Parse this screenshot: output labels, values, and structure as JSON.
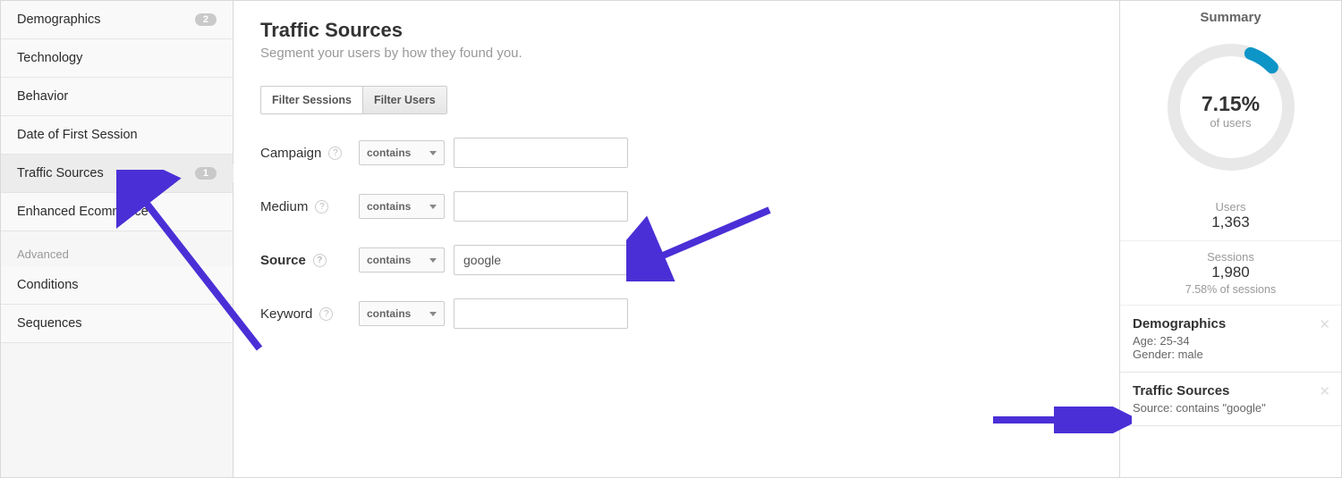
{
  "sidebar": {
    "items": [
      {
        "label": "Demographics",
        "badge": "2"
      },
      {
        "label": "Technology"
      },
      {
        "label": "Behavior"
      },
      {
        "label": "Date of First Session"
      },
      {
        "label": "Traffic Sources",
        "badge": "1",
        "active": true
      },
      {
        "label": "Enhanced Ecommerce"
      }
    ],
    "advanced_label": "Advanced",
    "advanced_items": [
      {
        "label": "Conditions"
      },
      {
        "label": "Sequences"
      }
    ]
  },
  "main": {
    "title": "Traffic Sources",
    "subtitle": "Segment your users by how they found you.",
    "filter_tabs": {
      "sessions": "Filter Sessions",
      "users": "Filter Users"
    },
    "fields": {
      "campaign": {
        "label": "Campaign",
        "op": "contains",
        "value": ""
      },
      "medium": {
        "label": "Medium",
        "op": "contains",
        "value": ""
      },
      "source": {
        "label": "Source",
        "op": "contains",
        "value": "google"
      },
      "keyword": {
        "label": "Keyword",
        "op": "contains",
        "value": ""
      }
    }
  },
  "summary": {
    "title": "Summary",
    "donut": {
      "percent": "7.15%",
      "sub": "of users",
      "fill_pct": 7.15
    },
    "users": {
      "label": "Users",
      "value": "1,363"
    },
    "sessions": {
      "label": "Sessions",
      "value": "1,980",
      "note": "7.58% of sessions"
    },
    "applied": [
      {
        "title": "Demographics",
        "lines": [
          "Age: 25-34",
          "Gender: male"
        ]
      },
      {
        "title": "Traffic Sources",
        "lines": [
          "Source: contains \"google\""
        ]
      }
    ]
  }
}
